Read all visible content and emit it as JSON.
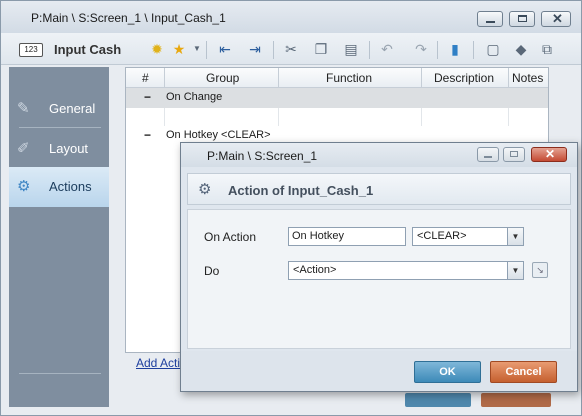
{
  "window": {
    "title": "P:Main \\ S:Screen_1 \\ Input_Cash_1",
    "controls": {
      "minimize": "minimize",
      "maximize": "maximize",
      "close": "close"
    }
  },
  "toolbar": {
    "badge": "123",
    "title": "Input Cash",
    "icons": [
      "lightbulb-icon",
      "star-icon",
      "indent-left-icon",
      "indent-right-icon",
      "cut-icon",
      "copy-icon",
      "paste-icon",
      "undo-icon",
      "redo-icon",
      "comment-icon",
      "chat-icon",
      "tag-icon",
      "edit-icon"
    ]
  },
  "sidebar": {
    "items": [
      {
        "label": "General",
        "icon": "general-icon",
        "active": false
      },
      {
        "label": "Layout",
        "icon": "layout-icon",
        "active": false
      },
      {
        "label": "Actions",
        "icon": "actions-icon",
        "active": true
      }
    ]
  },
  "grid": {
    "columns": [
      "#",
      "Group",
      "Function",
      "Description",
      "Notes"
    ],
    "rows": [
      {
        "marker": "−",
        "text": "On Change"
      },
      {
        "marker": "−",
        "text": "On Hotkey <CLEAR>"
      }
    ],
    "add_link": "Add Acti"
  },
  "dialog": {
    "title": "P:Main \\ S:Screen_1",
    "heading": "Action of Input_Cash_1",
    "on_action_label": "On Action",
    "on_action_value": "On Hotkey",
    "hotkey_value": "<CLEAR>",
    "do_label": "Do",
    "do_value": "<Action>",
    "ok_label": "OK",
    "cancel_label": "Cancel",
    "close_glyph": "✕"
  }
}
